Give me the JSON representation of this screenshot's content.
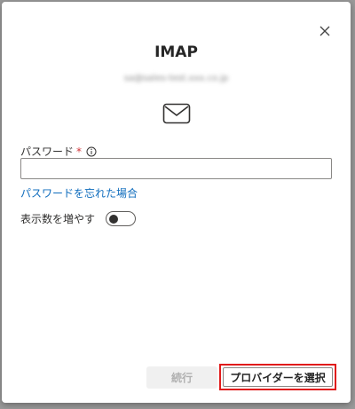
{
  "dialog": {
    "title": "IMAP",
    "email": "sa@sales-test.xxx.co.jp"
  },
  "password": {
    "label": "パスワード",
    "required_mark": "*",
    "value": "",
    "forgot_link": "パスワードを忘れた場合"
  },
  "show_more": {
    "label": "表示数を増やす",
    "toggle_on": false
  },
  "buttons": {
    "continue_label": "続行",
    "choose_provider_label": "プロバイダーを選択"
  },
  "colors": {
    "link": "#0f6cbd",
    "required": "#d13438",
    "highlight_box": "#e01b1b"
  },
  "icons": {
    "close": "close-icon",
    "mail": "mail-icon",
    "info": "info-icon"
  }
}
